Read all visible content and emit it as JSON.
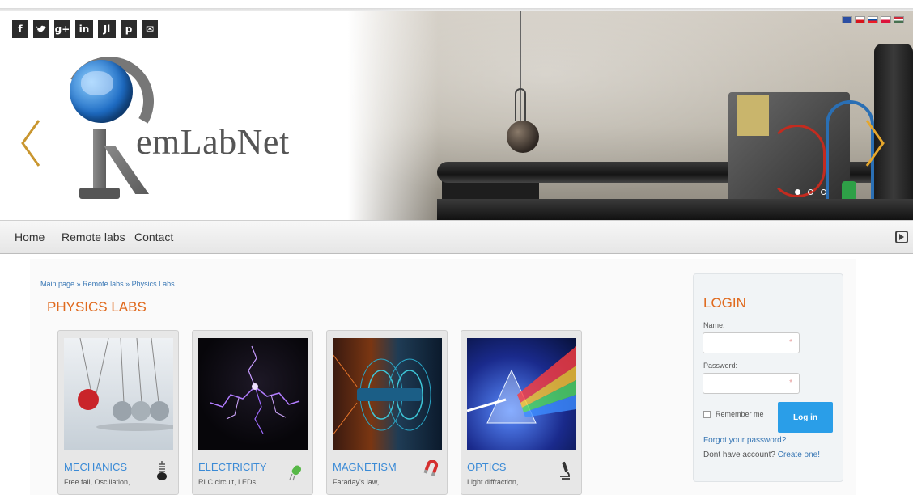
{
  "header": {
    "site_name": "emLabNet",
    "social": [
      "f",
      "t",
      "g+",
      "in",
      "Jl",
      "p",
      "✉"
    ],
    "flags": [
      {
        "name": "english",
        "color": "#2b4ea3"
      },
      {
        "name": "czech",
        "color": "#1f3b9e"
      },
      {
        "name": "slovak",
        "color": "#d92a2a"
      },
      {
        "name": "polish",
        "color": "#d9343b"
      },
      {
        "name": "hungarian",
        "color": "#2c8f3a"
      }
    ]
  },
  "nav": {
    "items": [
      "Home",
      "Remote labs",
      "Contact"
    ]
  },
  "breadcrumb": [
    "Main page",
    "Remote labs",
    "Physics Labs"
  ],
  "breadcrumb_sep": "»",
  "page_title": "PHYSICS LABS",
  "cards": [
    {
      "title": "MECHANICS",
      "desc": "Free fall, Oscillation, ...",
      "icon": "spring-weight-icon"
    },
    {
      "title": "ELECTRICITY",
      "desc": "RLC circuit, LEDs, ...",
      "icon": "led-icon"
    },
    {
      "title": "MAGNETISM",
      "desc": "Faraday's law, ...",
      "icon": "magnet-icon"
    },
    {
      "title": "OPTICS",
      "desc": "Light diffraction, ...",
      "icon": "microscope-icon"
    }
  ],
  "login": {
    "title": "LOGIN",
    "name_label": "Name:",
    "password_label": "Password:",
    "required_mark": "*",
    "remember_label": "Remember me",
    "login_button": "Log in",
    "forgot_link": "Forgot your password?",
    "no_account_text": "Dont have account?",
    "create_link": "Create one!"
  },
  "colors": {
    "accent_orange": "#e06a1e",
    "link_blue": "#3a78b5",
    "button_blue": "#2a9ee8"
  }
}
